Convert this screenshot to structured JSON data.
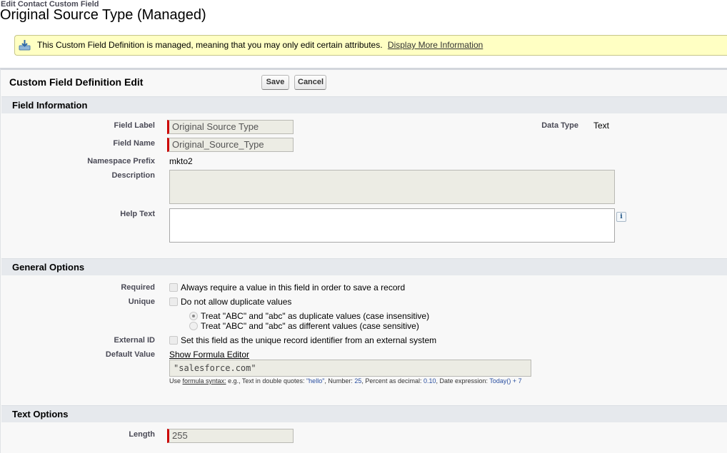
{
  "header": {
    "subtitle": "Edit Contact Custom Field",
    "title": "Original Source Type (Managed)"
  },
  "notice": {
    "message": "This Custom Field Definition is managed, meaning that you may only edit certain attributes.",
    "link": "Display More Information"
  },
  "panel": {
    "title": "Custom Field Definition Edit",
    "save_label": "Save",
    "cancel_label": "Cancel"
  },
  "field_information": {
    "heading": "Field Information",
    "field_label_label": "Field Label",
    "field_label_value": "Original Source Type",
    "field_name_label": "Field Name",
    "field_name_value": "Original_Source_Type",
    "namespace_label": "Namespace Prefix",
    "namespace_value": "mkto2",
    "description_label": "Description",
    "help_text_label": "Help Text",
    "info_glyph": "i",
    "data_type_label": "Data Type",
    "data_type_value": "Text"
  },
  "general_options": {
    "heading": "General Options",
    "required_label": "Required",
    "required_text": "Always require a value in this field in order to save a record",
    "unique_label": "Unique",
    "unique_text": "Do not allow duplicate values",
    "radio_insensitive": "Treat \"ABC\" and \"abc\" as duplicate values (case insensitive)",
    "radio_sensitive": "Treat \"ABC\" and \"abc\" as different values (case sensitive)",
    "external_id_label": "External ID",
    "external_id_text": "Set this field as the unique record identifier from an external system",
    "default_value_label": "Default Value",
    "formula_editor_link": "Show Formula Editor",
    "default_value": "\"salesforce.com\"",
    "hint": {
      "use": "Use",
      "syntax": "formula syntax:",
      "eg": " e.g., Text in double quotes: ",
      "hello": "\"hello\"",
      "number_label": ", Number: ",
      "number": "25",
      "percent_label": ", Percent as decimal: ",
      "percent": "0.10",
      "date_label": ", Date expression: ",
      "date": "Today() + 7"
    }
  },
  "text_options": {
    "heading": "Text Options",
    "length_label": "Length",
    "length_value": "255"
  },
  "colors": {
    "notice_bg": "#ffffc3",
    "section_bg": "#e6e9ed",
    "required_bar": "#cc0000"
  }
}
